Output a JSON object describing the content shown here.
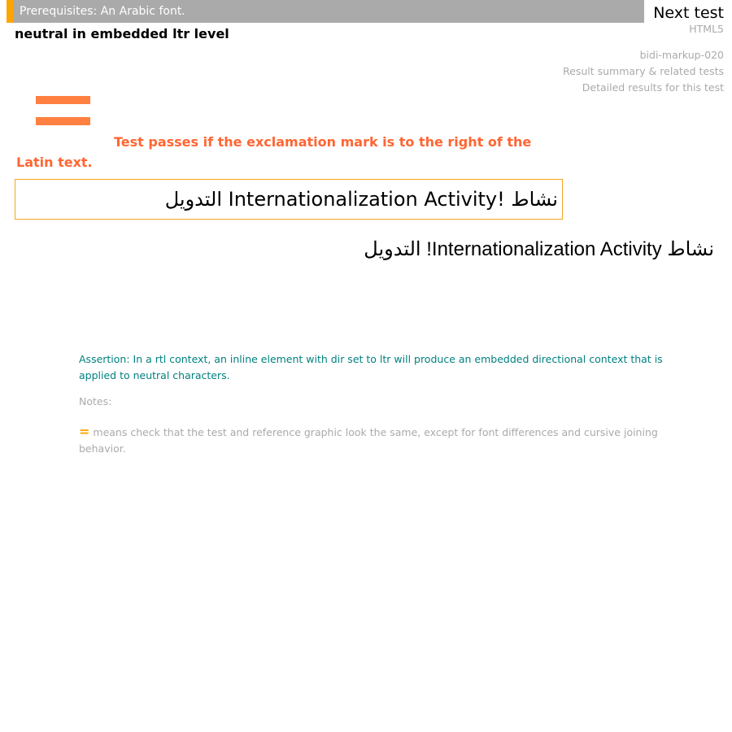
{
  "header": {
    "prerequisites": "Prerequisites: An Arabic font.",
    "next_test": "Next test",
    "title": "neutral in embedded ltr level"
  },
  "meta": {
    "format": "HTML5",
    "test_id": "bidi-markup-020",
    "summary_link": "Result summary & related tests",
    "detailed_link": "Detailed results for this test"
  },
  "instructions": "Test passes if the exclamation mark is to the right of the Latin text.",
  "test": {
    "rtl_word_1": "نشاط",
    "ltr_text": "Internationalization Activity!",
    "rtl_word_2": "التدويل"
  },
  "reference": {
    "text": "نشاط Internationalization Activity! التدويل"
  },
  "assertion": "Assertion: In a rtl context, an inline element with dir set to ltr will produce an embedded directional context that is applied to neutral characters.",
  "notes": {
    "label": "Notes:",
    "equals_symbol": "=",
    "equals_note": "means check that the test and reference graphic look the same, except for font differences and cursive joining behavior."
  },
  "colors": {
    "prereq_bar": "#aaaaaa",
    "prereq_accent": "#ffa500",
    "instructions": "#ff6633",
    "equals_icon": "#ff8040",
    "test_box_border": "#f5a623",
    "assertion": "#008080",
    "meta": "#aaaaaa"
  },
  "icons": {
    "equals": "equals-icon"
  }
}
